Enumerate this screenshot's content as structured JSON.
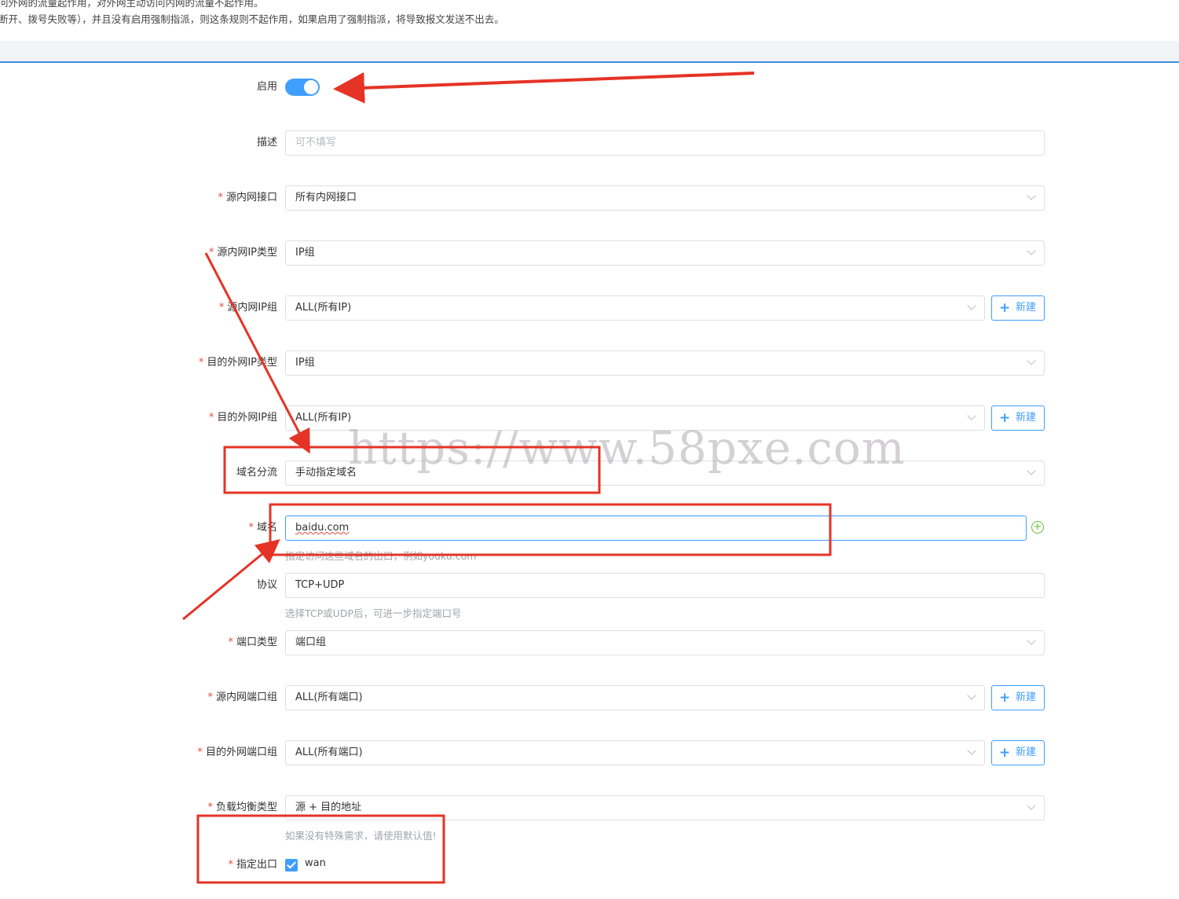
{
  "notice": {
    "line1": "问外网的流量起作用，对外网主动访问内网的流量不起作用。",
    "line2": "断开、拨号失败等），并且没有启用强制指派，则这条规则不起作用，如果启用了强制指派，将导致报文发送不出去。"
  },
  "form": {
    "enable_label": "启用",
    "enabled": true,
    "desc_label": "描述",
    "desc_placeholder": "可不填写",
    "src_iface_label": "源内网接口",
    "src_iface_value": "所有内网接口",
    "src_ip_type_label": "源内网IP类型",
    "src_ip_type_value": "IP组",
    "src_ip_group_label": "源内网IP组",
    "src_ip_group_value": "ALL(所有IP)",
    "dst_ip_type_label": "目的外网IP类型",
    "dst_ip_type_value": "IP组",
    "dst_ip_group_label": "目的外网IP组",
    "dst_ip_group_value": "ALL(所有IP)",
    "domain_split_label": "域名分流",
    "domain_split_value": "手动指定域名",
    "domain_label": "域名",
    "domain_value": "baidu.com",
    "domain_hint": "指定访问这些域名的出口，例如youku.com",
    "protocol_label": "协议",
    "protocol_value": "TCP+UDP",
    "protocol_hint": "选择TCP或UDP后，可进一步指定端口号",
    "port_type_label": "端口类型",
    "port_type_value": "端口组",
    "src_port_group_label": "源内网端口组",
    "src_port_group_value": "ALL(所有端口)",
    "dst_port_group_label": "目的外网端口组",
    "dst_port_group_value": "ALL(所有端口)",
    "lb_type_label": "负载均衡类型",
    "lb_type_value": "源 + 目的地址",
    "lb_hint": "如果没有特殊需求，请使用默认值!",
    "exit_label": "指定出口",
    "exit_option": "wan",
    "exit_checked": true,
    "required_mark": "*",
    "new_button": "新建",
    "plus_glyph": "+"
  },
  "watermark": "https://www.58pxe.com",
  "colors": {
    "primary": "#409eff",
    "annotation_red": "#e53326",
    "required": "#e84b3c",
    "add_green": "#5fbf3b"
  }
}
